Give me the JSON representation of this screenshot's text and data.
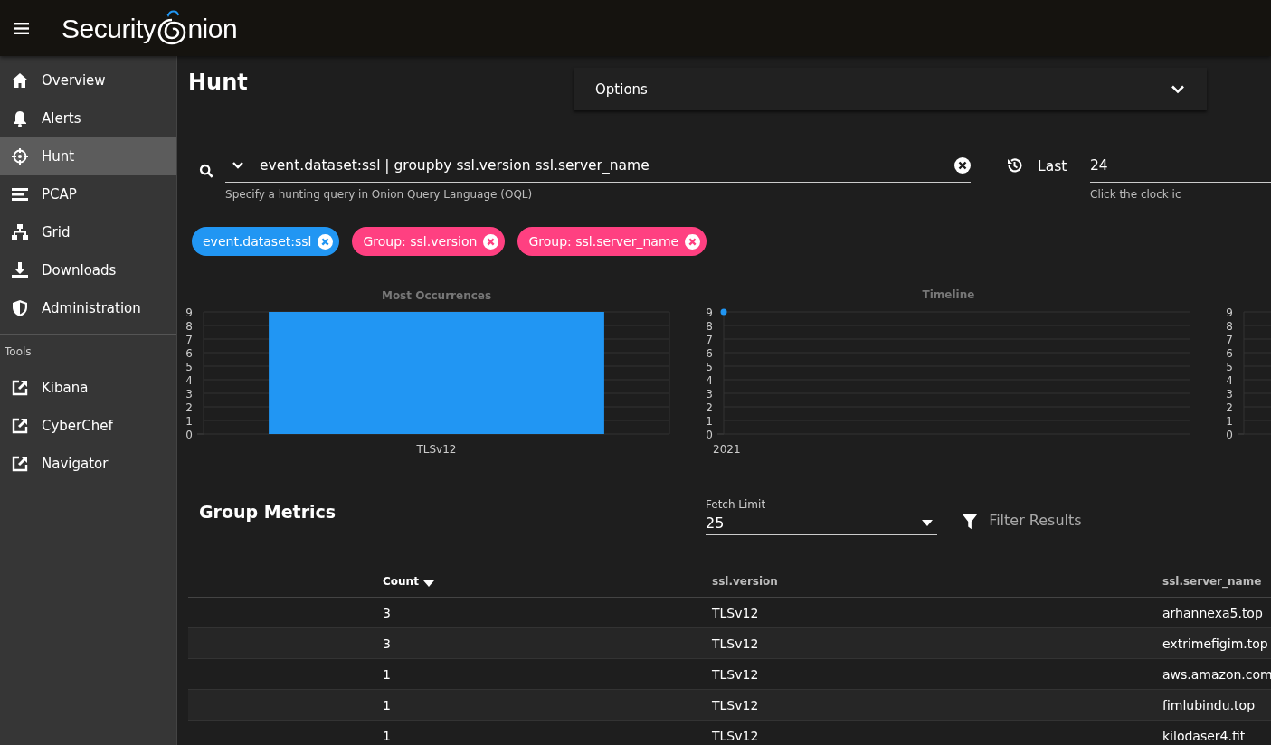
{
  "header": {
    "logo": {
      "before": "Security",
      "after": "nion"
    }
  },
  "sidebar": {
    "items": [
      {
        "label": "Overview",
        "selected": false
      },
      {
        "label": "Alerts",
        "selected": false
      },
      {
        "label": "Hunt",
        "selected": true
      },
      {
        "label": "PCAP",
        "selected": false
      },
      {
        "label": "Grid",
        "selected": false
      },
      {
        "label": "Downloads",
        "selected": false
      },
      {
        "label": "Administration",
        "selected": false
      }
    ],
    "tools_heading": "Tools",
    "tools": [
      {
        "label": "Kibana"
      },
      {
        "label": "CyberChef"
      },
      {
        "label": "Navigator"
      }
    ]
  },
  "page_title": "Hunt",
  "options": {
    "label": "Options",
    "expanded": false
  },
  "query": {
    "value": "event.dataset:ssl | groupby ssl.version ssl.server_name",
    "hint": "Specify a hunting query in Onion Query Language (OQL)"
  },
  "date_range": {
    "label": "Last",
    "value": "24",
    "hint": "Click the clock ic"
  },
  "chips": [
    {
      "label": "event.dataset:ssl",
      "color": "#2196f3"
    },
    {
      "label": "Group: ssl.version",
      "color": "#ff4081"
    },
    {
      "label": "Group: ssl.server_name",
      "color": "#ff4081"
    }
  ],
  "charts": [
    {
      "chart_data": {
        "type": "bar",
        "title": "Most Occurrences",
        "categories": [
          "TLSv12"
        ],
        "series": [
          {
            "color": "#2196f3",
            "values": [
              9
            ]
          }
        ],
        "ylim": [
          0,
          9
        ],
        "yticks": [
          0,
          1,
          2,
          3,
          4,
          5,
          6,
          7,
          8,
          9
        ],
        "grid": true
      }
    },
    {
      "title": "Timeline",
      "chart_data": {
        "type": "line",
        "x": [
          "2021"
        ],
        "series": [
          {
            "color": "#2196f3",
            "values": [
              9
            ],
            "marker": true
          }
        ],
        "ylim": [
          0,
          9
        ],
        "yticks": [
          0,
          1,
          2,
          3,
          4,
          5,
          6,
          7,
          8,
          9
        ],
        "grid": true
      }
    },
    {
      "chart_data": {
        "type": "bar",
        "categories": [
          null
        ],
        "series": [
          {
            "values": [
              null
            ]
          }
        ],
        "ylim": [
          0,
          9
        ],
        "yticks": [
          0,
          1,
          2,
          3,
          4,
          5,
          6,
          7,
          8,
          9
        ],
        "grid": true
      }
    }
  ],
  "group_metrics": {
    "title": "Group Metrics",
    "fetch_limit": {
      "label": "Fetch Limit",
      "value": "25"
    },
    "filter": {
      "placeholder": "Filter Results"
    },
    "table": {
      "columns": [
        {
          "label": "Count",
          "sorted": true
        },
        {
          "label": "ssl.version",
          "sorted": false
        },
        {
          "label": "ssl.server_name",
          "sorted": false
        }
      ],
      "rows": [
        [
          "3",
          "TLSv12",
          "arhannexa5.top"
        ],
        [
          "3",
          "TLSv12",
          "extrimefigim.top"
        ],
        [
          "1",
          "TLSv12",
          "aws.amazon.com"
        ],
        [
          "1",
          "TLSv12",
          "fimlubindu.top"
        ],
        [
          "1",
          "TLSv12",
          "kilodaser4.fit"
        ]
      ]
    }
  }
}
